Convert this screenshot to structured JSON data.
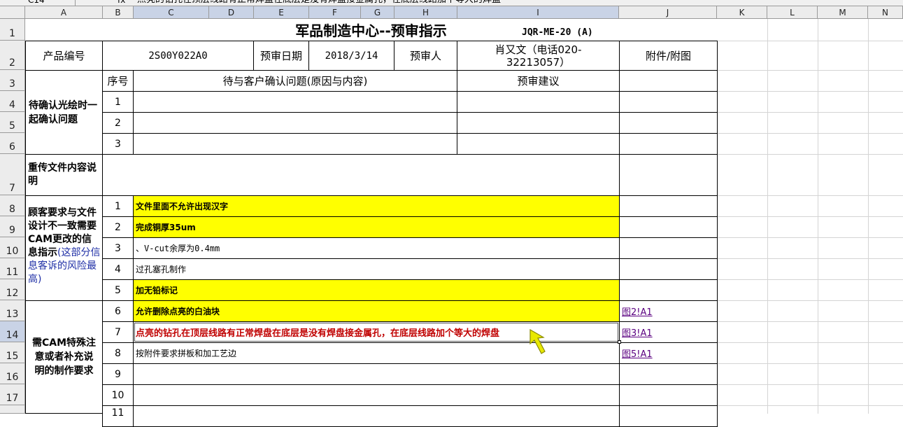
{
  "formula_bar": {
    "cell_ref": "C14",
    "fx": "fx",
    "content": "点亮的钻孔在顶层线路有正常焊盘在底层是没有焊盘接金属孔，在底层线路加个等大的焊盘"
  },
  "columns": [
    "A",
    "B",
    "C",
    "D",
    "E",
    "F",
    "G",
    "H",
    "I",
    "J",
    "K",
    "L",
    "M",
    "N"
  ],
  "rows": [
    "1",
    "2",
    "3",
    "4",
    "5",
    "6",
    "7",
    "8",
    "9",
    "10",
    "11",
    "12",
    "13",
    "14",
    "15",
    "16",
    "17"
  ],
  "title": "军品制造中心--预审指示",
  "doc_code": "JQR-ME-20 (A)",
  "header": {
    "product_no_label": "产品编号",
    "product_no": "2S00Y022A0",
    "date_label": "预审日期",
    "date": "2018/3/14",
    "reviewer_label": "预审人",
    "reviewer": "肖又文（电话020-32213057）",
    "attachment_label": "附件/附图"
  },
  "confirm_section": {
    "label": "待确认光绘时一起确认问题",
    "seq_header": "序号",
    "issue_header": "待与客户确认问题(原因与内容)",
    "suggest_header": "预审建议",
    "items": [
      "1",
      "2",
      "3"
    ]
  },
  "resend_section": {
    "label": "重传文件内容说明"
  },
  "requirements_section": {
    "label_main": "顾客要求与文件设计不一致需要CAM更改的信息指示",
    "label_note": "(这部分信息客诉的风险最高)",
    "items": [
      {
        "no": "1",
        "text": "文件里面不允许出现汉字"
      },
      {
        "no": "2",
        "text": "完成铜厚35um"
      },
      {
        "no": "3",
        "text": "、V-cut余厚为0.4mm"
      },
      {
        "no": "4",
        "text": "过孔塞孔制作"
      },
      {
        "no": "5",
        "text": "加无铅标记"
      }
    ]
  },
  "cam_section": {
    "label": "需CAM特殊注意或者补充说明的制作要求",
    "items": [
      {
        "no": "6",
        "text": "允许删除点亮的白油块",
        "link": "图2!A1"
      },
      {
        "no": "7",
        "text": "点亮的钻孔在顶层线路有正常焊盘在底层是没有焊盘接金属孔，在底层线路加个等大的焊盘",
        "link": "图3!A1"
      },
      {
        "no": "8",
        "text": "按附件要求拼板和加工艺边",
        "link": "图5!A1"
      },
      {
        "no": "9",
        "text": "",
        "link": ""
      },
      {
        "no": "10",
        "text": "",
        "link": ""
      },
      {
        "no": "11",
        "text": "",
        "link": ""
      }
    ]
  },
  "colors": {
    "highlight": "#ffff00",
    "header_bg": "#ececec",
    "selected_header": "#c9d3e6",
    "red_text": "#c00000",
    "cursor_arrow": "#e8e800"
  }
}
